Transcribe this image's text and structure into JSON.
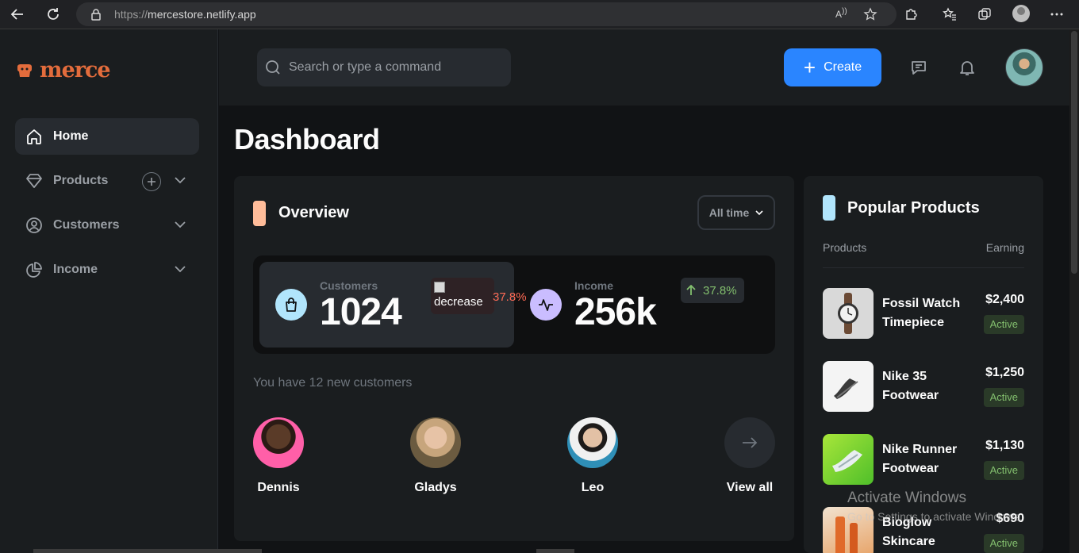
{
  "browser": {
    "url_protocol": "https://",
    "url_host": "mercestore.netlify.app"
  },
  "sidebar": {
    "logo_text": "merce",
    "items": [
      {
        "label": "Home",
        "icon": "home-icon",
        "active": true
      },
      {
        "label": "Products",
        "icon": "diamond-icon",
        "active": false
      },
      {
        "label": "Customers",
        "icon": "user-circle-icon",
        "active": false
      },
      {
        "label": "Income",
        "icon": "pie-chart-icon",
        "active": false
      }
    ]
  },
  "header": {
    "search_placeholder": "Search or type a command",
    "create_label": "Create"
  },
  "page": {
    "title": "Dashboard"
  },
  "overview": {
    "title": "Overview",
    "filter_label": "All time",
    "customers": {
      "label": "Customers",
      "value": "1024",
      "change_img_alt": "decrease",
      "change_pct": "37.8%"
    },
    "income": {
      "label": "Income",
      "value": "256k",
      "change_pct": "37.8%"
    },
    "new_customers_text": "You have 12 new customers",
    "customers_list": [
      {
        "name": "Dennis"
      },
      {
        "name": "Gladys"
      },
      {
        "name": "Leo"
      }
    ],
    "view_all_label": "View all"
  },
  "popular": {
    "title": "Popular Products",
    "col_products": "Products",
    "col_earning": "Earning",
    "products": [
      {
        "name": "Fossil Watch Timepiece",
        "price": "$2,400",
        "status": "Active"
      },
      {
        "name": "Nike 35 Footwear",
        "price": "$1,250",
        "status": "Active"
      },
      {
        "name": "Nike Runner Footwear",
        "price": "$1,130",
        "status": "Active"
      },
      {
        "name": "Bioglow Skincare",
        "price": "$690",
        "status": "Active"
      }
    ]
  },
  "watermark": {
    "line1": "Activate Windows",
    "line2": "Go to Settings to activate Windows."
  },
  "colors": {
    "accent_blue": "#2a85ff",
    "logo_orange": "#e36c3c",
    "decrease_red": "#ff6a55",
    "increase_green": "#83bf6e"
  }
}
